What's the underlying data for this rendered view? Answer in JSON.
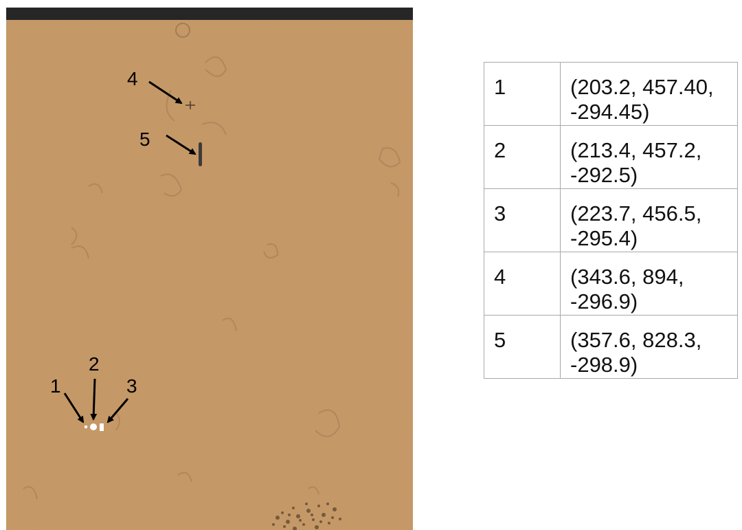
{
  "figure": {
    "labels": [
      "1",
      "2",
      "3",
      "4",
      "5"
    ]
  },
  "table": {
    "rows": [
      {
        "index": "1",
        "line1": "(203.2, 457.40,",
        "line2": "-294.45)"
      },
      {
        "index": "2",
        "line1": "(213.4, 457.2,",
        "line2": "-292.5)"
      },
      {
        "index": "3",
        "line1": "(223.7, 456.5,",
        "line2": "-295.4)"
      },
      {
        "index": "4",
        "line1": "(343.6, 894,",
        "line2": "-296.9)"
      },
      {
        "index": "5",
        "line1": "(357.6, 828.3,",
        "line2": "-298.9)"
      }
    ]
  },
  "colors": {
    "background": "#c99a66",
    "top_bar": "#262626",
    "arrow": "#000000",
    "markers": "#ffffff"
  }
}
